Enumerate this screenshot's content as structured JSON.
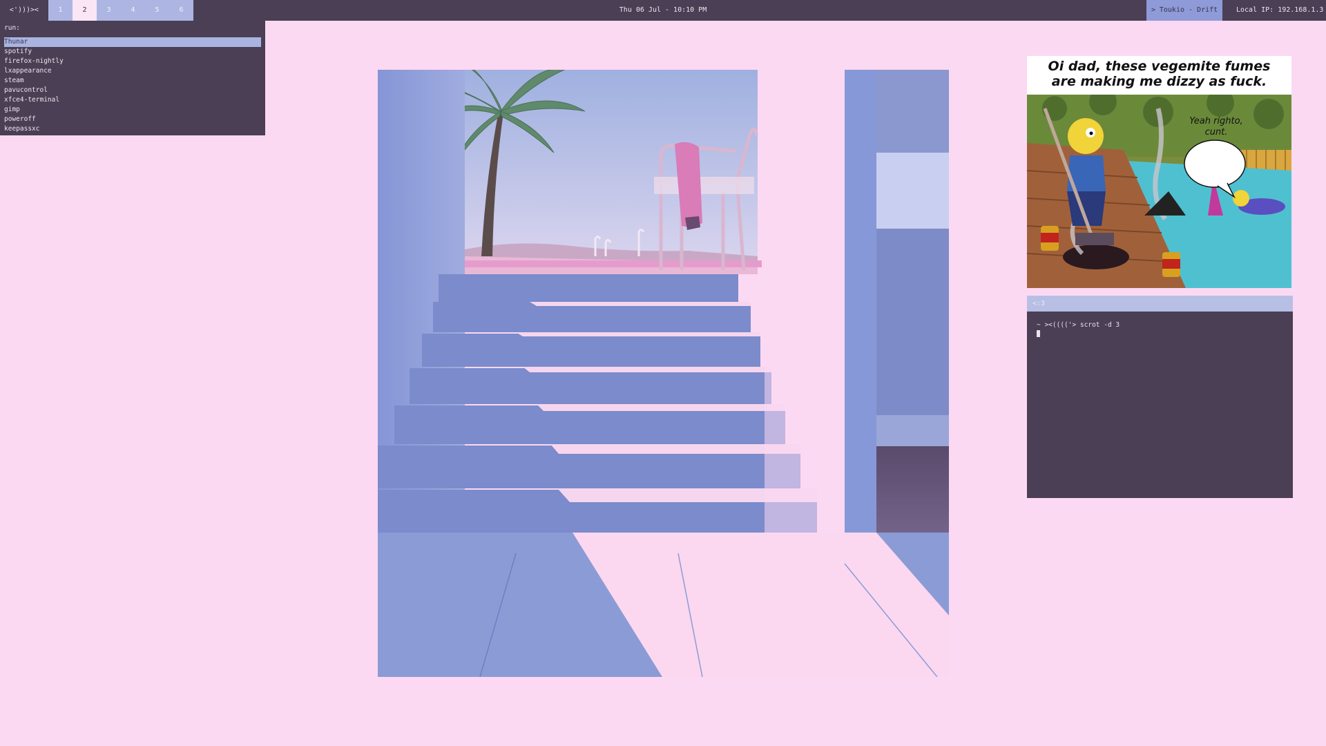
{
  "topbar": {
    "logo": "<')))><",
    "workspaces": [
      "1",
      "2",
      "3",
      "4",
      "5",
      "6"
    ],
    "active_workspace": "2",
    "clock": "Thu 06 Jul - 10:10 PM",
    "now_playing": "> Toukio - Drift",
    "local_ip": "Local IP:  192.168.1.3"
  },
  "launcher": {
    "prompt": "run:",
    "items": [
      "Thunar",
      "spotify",
      "firefox-nightly",
      "lxappearance",
      "steam",
      "pavucontrol",
      "xfce4-terminal",
      "gimp",
      "poweroff",
      "keepassxc"
    ],
    "selected_index": 0
  },
  "meme": {
    "caption": "Oi dad, these vegemite fumes are making me dizzy as fuck.",
    "speech_bubble": "Yeah righto, cunt."
  },
  "terminal": {
    "title": "<:3",
    "prompt_line": "~ ><(((('> scrot -d 3"
  },
  "colors": {
    "desktop_bg": "#fcd9f2",
    "bar_bg": "#4a3f54",
    "workspace_bg": "#adb6e2",
    "workspace_active_bg": "#fbe6f6",
    "accent": "#8f9ad8",
    "selection": "#a9b4e1"
  }
}
